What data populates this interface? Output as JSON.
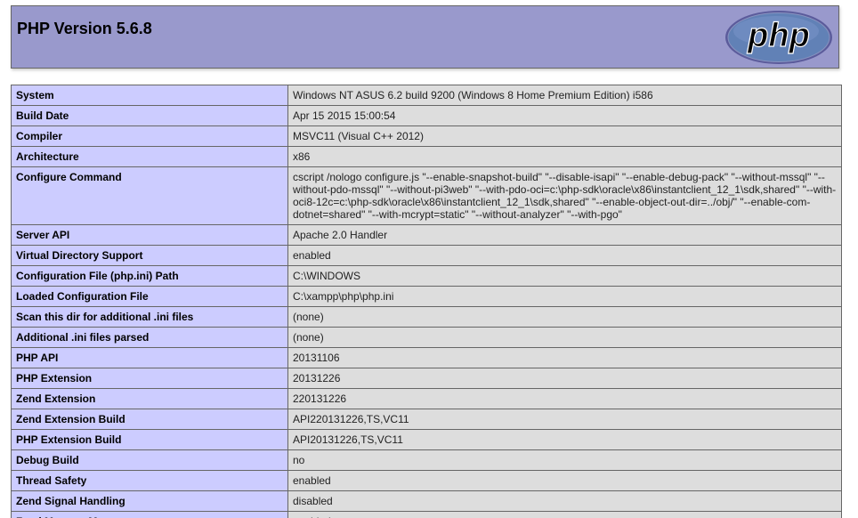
{
  "header": {
    "title": "PHP Version 5.6.8",
    "logo_text": "php",
    "logo_color": "#6181b6",
    "background": "#9999cc"
  },
  "rows": [
    {
      "label": "System",
      "value": "Windows NT ASUS 6.2 build 9200 (Windows 8 Home Premium Edition) i586"
    },
    {
      "label": "Build Date",
      "value": "Apr 15 2015 15:00:54"
    },
    {
      "label": "Compiler",
      "value": "MSVC11 (Visual C++ 2012)"
    },
    {
      "label": "Architecture",
      "value": "x86"
    },
    {
      "label": "Configure Command",
      "value": "cscript /nologo configure.js \"--enable-snapshot-build\" \"--disable-isapi\" \"--enable-debug-pack\" \"--without-mssql\" \"--without-pdo-mssql\" \"--without-pi3web\" \"--with-pdo-oci=c:\\php-sdk\\oracle\\x86\\instantclient_12_1\\sdk,shared\" \"--with-oci8-12c=c:\\php-sdk\\oracle\\x86\\instantclient_12_1\\sdk,shared\" \"--enable-object-out-dir=../obj/\" \"--enable-com-dotnet=shared\" \"--with-mcrypt=static\" \"--without-analyzer\" \"--with-pgo\""
    },
    {
      "label": "Server API",
      "value": "Apache 2.0 Handler"
    },
    {
      "label": "Virtual Directory Support",
      "value": "enabled"
    },
    {
      "label": "Configuration File (php.ini) Path",
      "value": "C:\\WINDOWS"
    },
    {
      "label": "Loaded Configuration File",
      "value": "C:\\xampp\\php\\php.ini"
    },
    {
      "label": "Scan this dir for additional .ini files",
      "value": "(none)"
    },
    {
      "label": "Additional .ini files parsed",
      "value": "(none)"
    },
    {
      "label": "PHP API",
      "value": "20131106"
    },
    {
      "label": "PHP Extension",
      "value": "20131226"
    },
    {
      "label": "Zend Extension",
      "value": "220131226"
    },
    {
      "label": "Zend Extension Build",
      "value": "API220131226,TS,VC11"
    },
    {
      "label": "PHP Extension Build",
      "value": "API20131226,TS,VC11"
    },
    {
      "label": "Debug Build",
      "value": "no"
    },
    {
      "label": "Thread Safety",
      "value": "enabled"
    },
    {
      "label": "Zend Signal Handling",
      "value": "disabled"
    },
    {
      "label": "Zend Memory Manager",
      "value": "enabled"
    }
  ]
}
